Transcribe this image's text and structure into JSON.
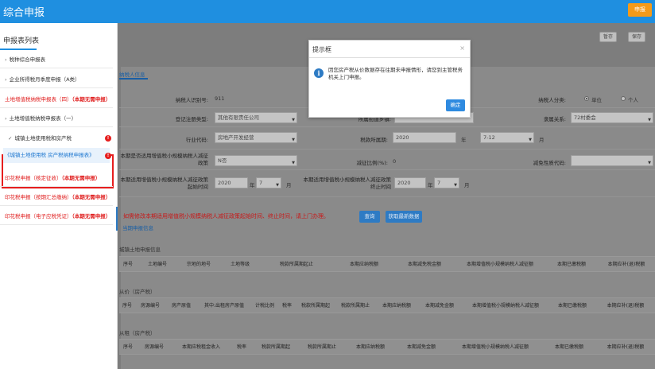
{
  "header": {
    "title": "综合申报",
    "report_button": "申报"
  },
  "sidebar": {
    "title": "申报表列表",
    "items": [
      {
        "label": "税种综合申报表"
      },
      {
        "label": "企业所得税月季度申报（A类）"
      },
      {
        "label": "土地增值税纳税申报表（四）",
        "suffix": "（本期无需申报）"
      },
      {
        "label": "土地增值税纳税申报表（一）"
      },
      {
        "label": "城镇土地使用税和房产税"
      },
      {
        "label": "印花税申报（核定征收）",
        "suffix": "（本期无需申报）"
      },
      {
        "label": "印花税申报（按期汇总缴纳）",
        "suffix": "（本期无需申报）"
      },
      {
        "label": "印花税申报（电子应税凭证）",
        "suffix": "（本期无需申报）"
      }
    ],
    "sub_item": "《城镇土地使用税 房产税纳税申报表》",
    "badge": "!"
  },
  "toolbar": {
    "save_draft": "暂存",
    "save": "保存"
  },
  "tab": "纳税人信息",
  "form": {
    "taxpayer_id_label": "纳税人识别号:",
    "taxpayer_id_value": "911",
    "taxpayer_class_label": "纳税人分类:",
    "radio_unit": "单位",
    "radio_person": "个人",
    "reg_type_label": "登记注册类型:",
    "reg_type_value": "其他有限责任公司",
    "district_label": "所属街道乡镇:",
    "affiliation_label": "隶属关系:",
    "affiliation_value": "72村委会",
    "industry_label": "行业代码:",
    "industry_value": "房地产开发经营",
    "period_label": "税款所属期:",
    "period_year": "2020",
    "year_unit": "年",
    "period_month": "7-12",
    "month_unit": "月",
    "small_scale_label": "本期是否适用增值税小规模纳税人减征政策",
    "small_scale_value": "N否",
    "reduce_ratio_label": "减征比例(%):",
    "reduce_ratio_value": "0",
    "reduce_code_label": "减免性质代码:",
    "start_time_label": "本期适用增值税小规模纳税人减征政策起始时间",
    "start_year": "2020",
    "start_month": "7",
    "end_time_label": "本期适用增值税小规模纳税人减征政策终止时间",
    "end_year": "2020",
    "end_month": "7"
  },
  "buttons": {
    "query": "查询",
    "fetch_latest": "获取最新数据"
  },
  "notice": "如需修改本期适用增值税小规模纳税人减征政策起始时间、终止时间，请上门办理。",
  "sections": {
    "current_info": "当期申报信息",
    "land_tax": "城镇土地申报信息",
    "ad_valorem": "从价（房产税）",
    "rent_based": "从租（房产税）"
  },
  "land_table_headers": [
    "序号",
    "土地编号",
    "宗地的地号",
    "土地等级",
    "税款所属期起止",
    "本期应纳税额",
    "本期减免税金额",
    "本期增值税小规模纳税人减征额",
    "本期已缴税额",
    "本期应补(退)税额"
  ],
  "ad_valorem_headers": [
    "序号",
    "房源编号",
    "房产原值",
    "其中:出租房产原值",
    "计税比例",
    "税率",
    "税款所属期起",
    "税款所属期止",
    "本期应纳税额",
    "本期减免金额",
    "本期增值税小规模纳税人减征额",
    "本期已缴税额",
    "本期应补(退)税额"
  ],
  "rent_headers": [
    "序号",
    "房源编号",
    "本期应税租金收入",
    "税率",
    "税款所属期起",
    "税款所属期止",
    "本期应纳税额",
    "本期减免金额",
    "本期增值税小规模纳税人减征额",
    "本期已缴税额",
    "本期应补(退)税额"
  ],
  "modal": {
    "title": "提示框",
    "close": "×",
    "message": "因您房产税从价数据存在往期未申报情形，请您到主管税务机关上门申报。",
    "ok": "确定",
    "icon": "i"
  }
}
